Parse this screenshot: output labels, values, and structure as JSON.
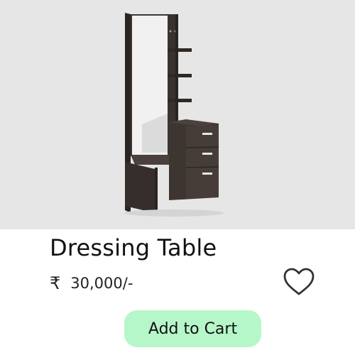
{
  "product": {
    "image_alt": "Dressing Table",
    "name": "Dressing Table",
    "currency_symbol": "₹",
    "price": "30,000/-",
    "wishlist_icon": "heart-outline-icon",
    "add_to_cart_label": "Add to Cart"
  },
  "colors": {
    "image_background": "#e6e6e6",
    "button_background": "#b6f7c9",
    "wood": "#3b3431"
  }
}
